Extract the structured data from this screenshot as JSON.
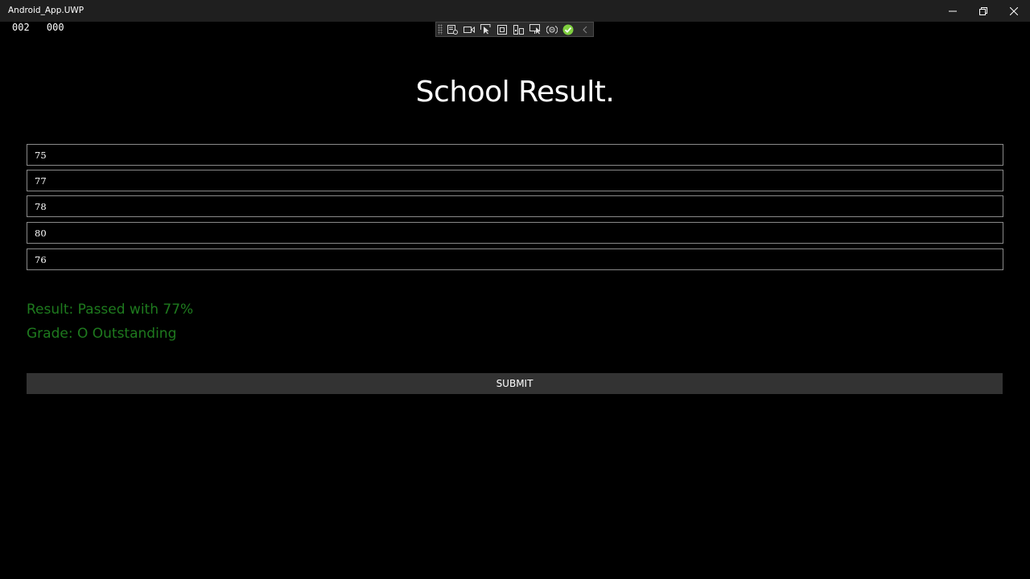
{
  "window": {
    "title": "Android_App.UWP",
    "buttons": [
      "minimize-icon",
      "restore-icon",
      "close-icon"
    ]
  },
  "counters": [
    "002",
    "000"
  ],
  "debug_toolbar": {
    "icons": [
      "live-visual-tree-icon",
      "record-icon",
      "select-element-icon",
      "layout-adorner-icon",
      "track-focus-icon",
      "display-layout-icon",
      "binding-failures-icon",
      "hot-reload-check-icon",
      "collapse-chevron-icon"
    ]
  },
  "page": {
    "heading": "School Result."
  },
  "marks": [
    "75",
    "77",
    "78",
    "80",
    "76"
  ],
  "result": {
    "result_text": "Result: Passed with 77%",
    "grade_text": "Grade: O Outstanding",
    "color": "#1e7a1e"
  },
  "submit_label": "SUBMIT"
}
